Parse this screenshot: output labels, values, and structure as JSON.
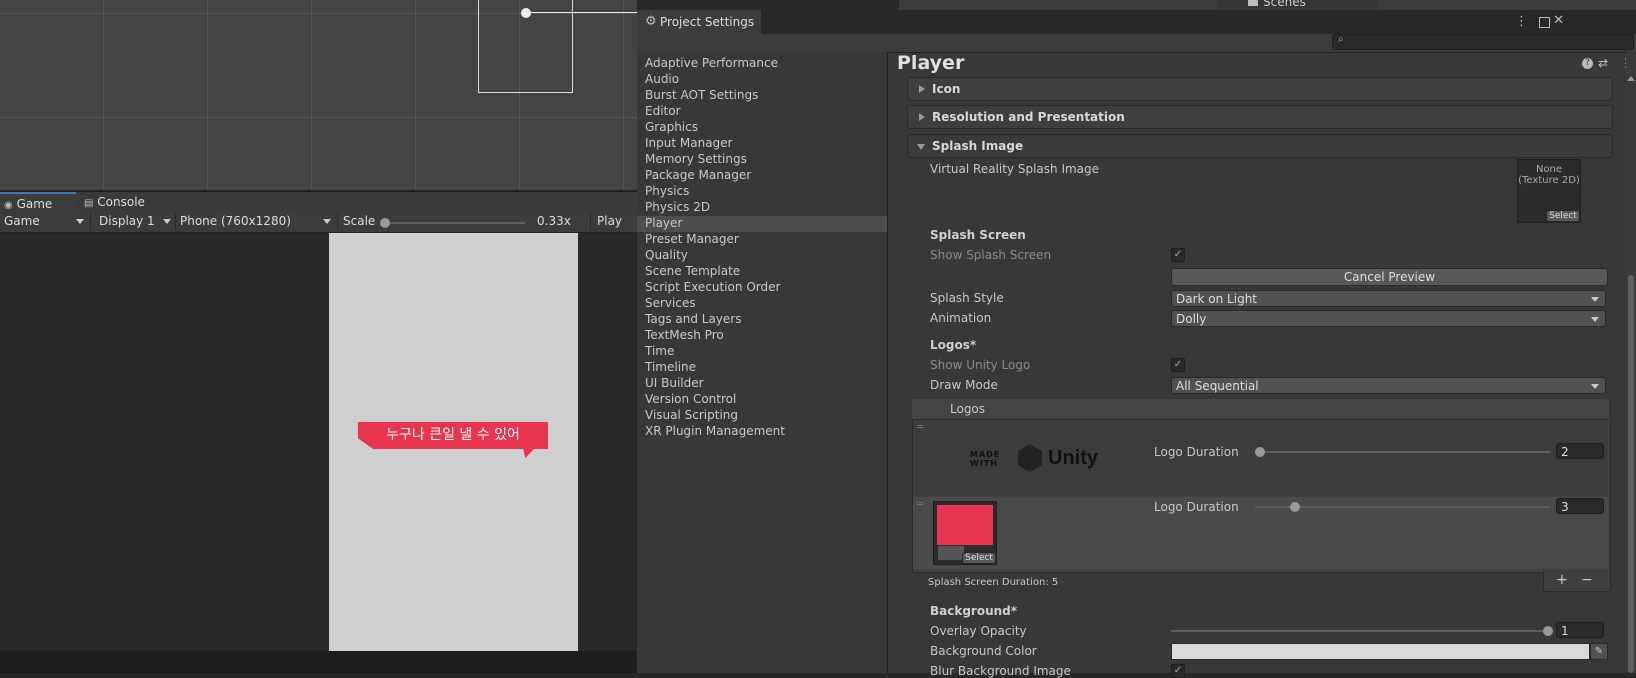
{
  "scene": {},
  "game_window": {
    "tabs": [
      {
        "label": "Game",
        "icon": "gamepad-icon"
      },
      {
        "label": "Console",
        "icon": "console-icon"
      }
    ],
    "toolbar": {
      "view_mode": "Game",
      "display": "Display 1",
      "resolution": "Phone (760x1280)",
      "scale_label": "Scale",
      "scale_value": "0.33x",
      "play_focus": "Play Fo"
    },
    "banner_text": "누구나 큰일 낼 수 있어"
  },
  "project_settings": {
    "title": "Project Settings",
    "search_placeholder": "",
    "nav_items": [
      "Adaptive Performance",
      "Audio",
      "Burst AOT Settings",
      "Editor",
      "Graphics",
      "Input Manager",
      "Memory Settings",
      "Package Manager",
      "Physics",
      "Physics 2D",
      "Player",
      "Preset Manager",
      "Quality",
      "Scene Template",
      "Script Execution Order",
      "Services",
      "Tags and Layers",
      "TextMesh Pro",
      "Time",
      "Timeline",
      "UI Builder",
      "Version Control",
      "Visual Scripting",
      "XR Plugin Management"
    ],
    "selected_nav": "Player",
    "panel_title": "Player",
    "sections": {
      "icon": "Icon",
      "resolution": "Resolution and Presentation",
      "splash": "Splash Image"
    },
    "splash": {
      "vr_label": "Virtual Reality Splash Image",
      "vr_none": "None",
      "vr_type": "(Texture 2D)",
      "vr_select": "Select",
      "splash_screen_header": "Splash Screen",
      "show_splash_label": "Show Splash Screen",
      "show_splash_checked": true,
      "cancel_preview": "Cancel Preview",
      "splash_style_label": "Splash Style",
      "splash_style_value": "Dark on Light",
      "animation_label": "Animation",
      "animation_value": "Dolly",
      "logos_header": "Logos*",
      "show_unity_logo_label": "Show Unity Logo",
      "show_unity_logo_checked": true,
      "draw_mode_label": "Draw Mode",
      "draw_mode_value": "All Sequential",
      "logos_list_header": "Logos",
      "logos": [
        {
          "logo_made": "MADE",
          "logo_with": "WITH",
          "logo_brand": "Unity",
          "duration_label": "Logo Duration",
          "duration": "2",
          "slider_fraction": 0.0
        },
        {
          "duration_label": "Logo Duration",
          "duration": "3",
          "select": "Select",
          "slider_fraction": 0.13
        }
      ],
      "splash_duration": "Splash Screen Duration: 5",
      "add_button": "+",
      "remove_button": "−",
      "background_header": "Background*",
      "overlay_opacity_label": "Overlay Opacity",
      "overlay_opacity_value": "1",
      "background_color_label": "Background Color",
      "background_color": "#d9d9d9",
      "blur_label": "Blur Background Image"
    }
  },
  "other_window": {
    "scenes_label": "Scenes"
  }
}
